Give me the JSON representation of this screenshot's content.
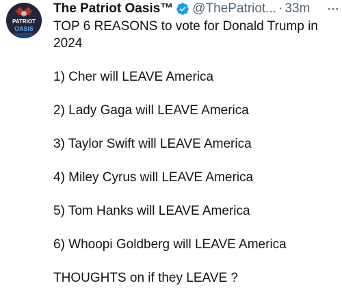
{
  "tweet": {
    "display_name": "The Patriot Oasis™",
    "handle": "@ThePatriot...",
    "separator": "·",
    "time": "33m",
    "avatar": {
      "text_line1": "PATRIOT",
      "text_line2": "OASIS"
    },
    "text_lines": [
      "TOP 6 REASONS to vote for Donald Trump in",
      "2024",
      "",
      "1) Cher will LEAVE America",
      "",
      "2) Lady Gaga will LEAVE America",
      "",
      "3) Taylor Swift will LEAVE America",
      "",
      "4) Miley Cyrus will LEAVE America",
      "",
      "5) Tom Hanks will LEAVE America",
      "",
      "6) Whoopi Goldberg will LEAVE America",
      "",
      "THOUGHTS on if they LEAVE ?"
    ]
  },
  "colors": {
    "text_primary": "#0f1419",
    "text_secondary": "#536471",
    "verified_badge": "#1d9bf0"
  },
  "icons": {
    "verified": "verified-badge-icon",
    "more": "more-options-icon"
  }
}
